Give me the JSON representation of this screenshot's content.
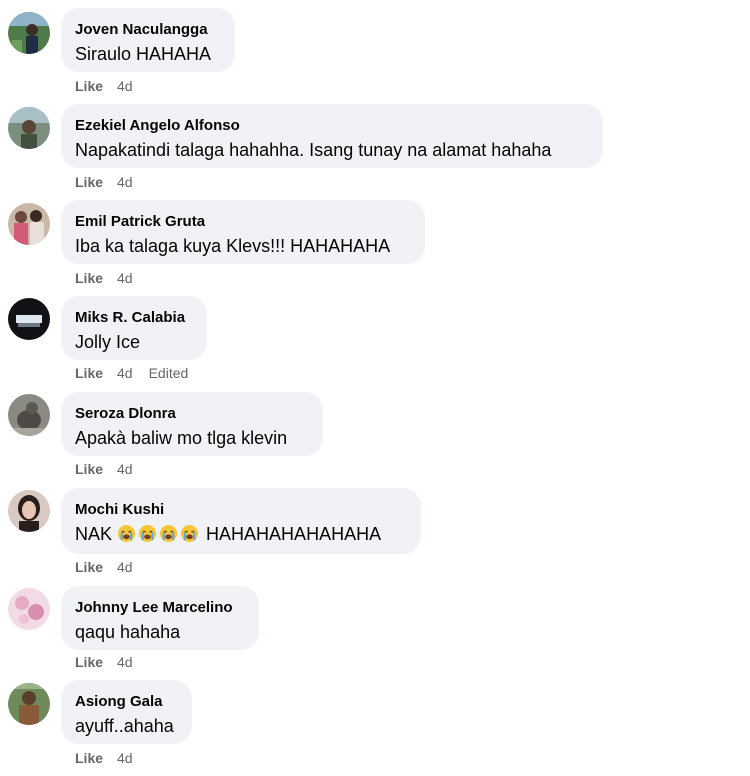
{
  "comments": [
    {
      "author": "Joven Naculangga",
      "text": "Siraulo HAHAHA",
      "like_label": "Like",
      "time": "4d",
      "avatar_icon": "user-photo-outdoor"
    },
    {
      "author": "Ezekiel Angelo Alfonso",
      "text": "Napakatindi talaga hahahha. Isang tunay na alamat hahaha",
      "like_label": "Like",
      "time": "4d",
      "avatar_icon": "user-photo-outdoor"
    },
    {
      "author": "Emil Patrick Gruta",
      "text": "Iba ka talaga kuya Klevs!!! HAHAHAHA",
      "like_label": "Like",
      "time": "4d",
      "avatar_icon": "user-photo-group"
    },
    {
      "author": "Miks R. Calabia",
      "text": "Jolly Ice",
      "like_label": "Like",
      "time": "4d",
      "edited_label": "Edited",
      "avatar_icon": "user-photo-dark"
    },
    {
      "author": "Seroza Dlonra",
      "text": "Apakà baliw mo tlga klevin",
      "like_label": "Like",
      "time": "4d",
      "avatar_icon": "user-photo-animal"
    },
    {
      "author": "Mochi Kushi",
      "text_prefix": "NAK",
      "text_suffix": "HAHAHAHAHAHAHA",
      "emoji_name": "loudly-crying-face-emoji",
      "emoji_count": 4,
      "like_label": "Like",
      "time": "4d",
      "avatar_icon": "user-photo-portrait"
    },
    {
      "author": "Johnny Lee Marcelino",
      "text": "qaqu hahaha",
      "like_label": "Like",
      "time": "4d",
      "avatar_icon": "user-photo-pink"
    },
    {
      "author": "Asiong Gala",
      "text": "ayuff..ahaha",
      "like_label": "Like",
      "time": "4d",
      "avatar_icon": "user-photo-person"
    }
  ],
  "colors": {
    "bubble_bg": "#f0f2f5",
    "secondary_text": "#65676b",
    "primary_text": "#050505"
  }
}
